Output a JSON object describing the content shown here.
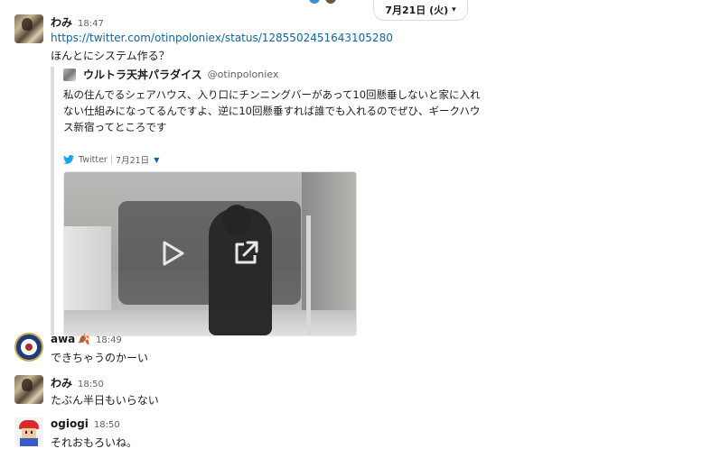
{
  "date_divider": {
    "label": "7月21日 (火)"
  },
  "messages": [
    {
      "author": "わみ",
      "time": "18:47",
      "link": "https://twitter.com/otinpoloniex/status/1285502451643105280",
      "text": "ほんとにシステム作る？",
      "quote": {
        "author": "ウルトラ天丼パラダイス",
        "handle": "@otinpoloniex",
        "body": "私の住んでるシェアハウス、入り口にチンニングバーがあって10回懸垂しないと家に入れ\nない仕組みになってるんですよ、逆に10回懸垂すれば誰でも入れるのでぜひ、ギークハウ\nス新宿ってところです",
        "source": "Twitter",
        "date": "7月21日"
      }
    },
    {
      "author": "awa",
      "emoji": "🍂",
      "time": "18:49",
      "text": "できちゃうのかーい"
    },
    {
      "author": "わみ",
      "time": "18:50",
      "text": "たぶん半日もいらない"
    },
    {
      "author": "ogiogi",
      "time": "18:50",
      "text": "それおもろいね。"
    }
  ],
  "colors": {
    "link": "#1264a3",
    "text": "#1d1c1d",
    "muted": "#616061",
    "quote_bar": "#dddddd"
  },
  "icons": [
    "twitter-bird-icon",
    "play-icon",
    "external-link-icon",
    "chevron-down-icon",
    "caret-down-icon"
  ]
}
